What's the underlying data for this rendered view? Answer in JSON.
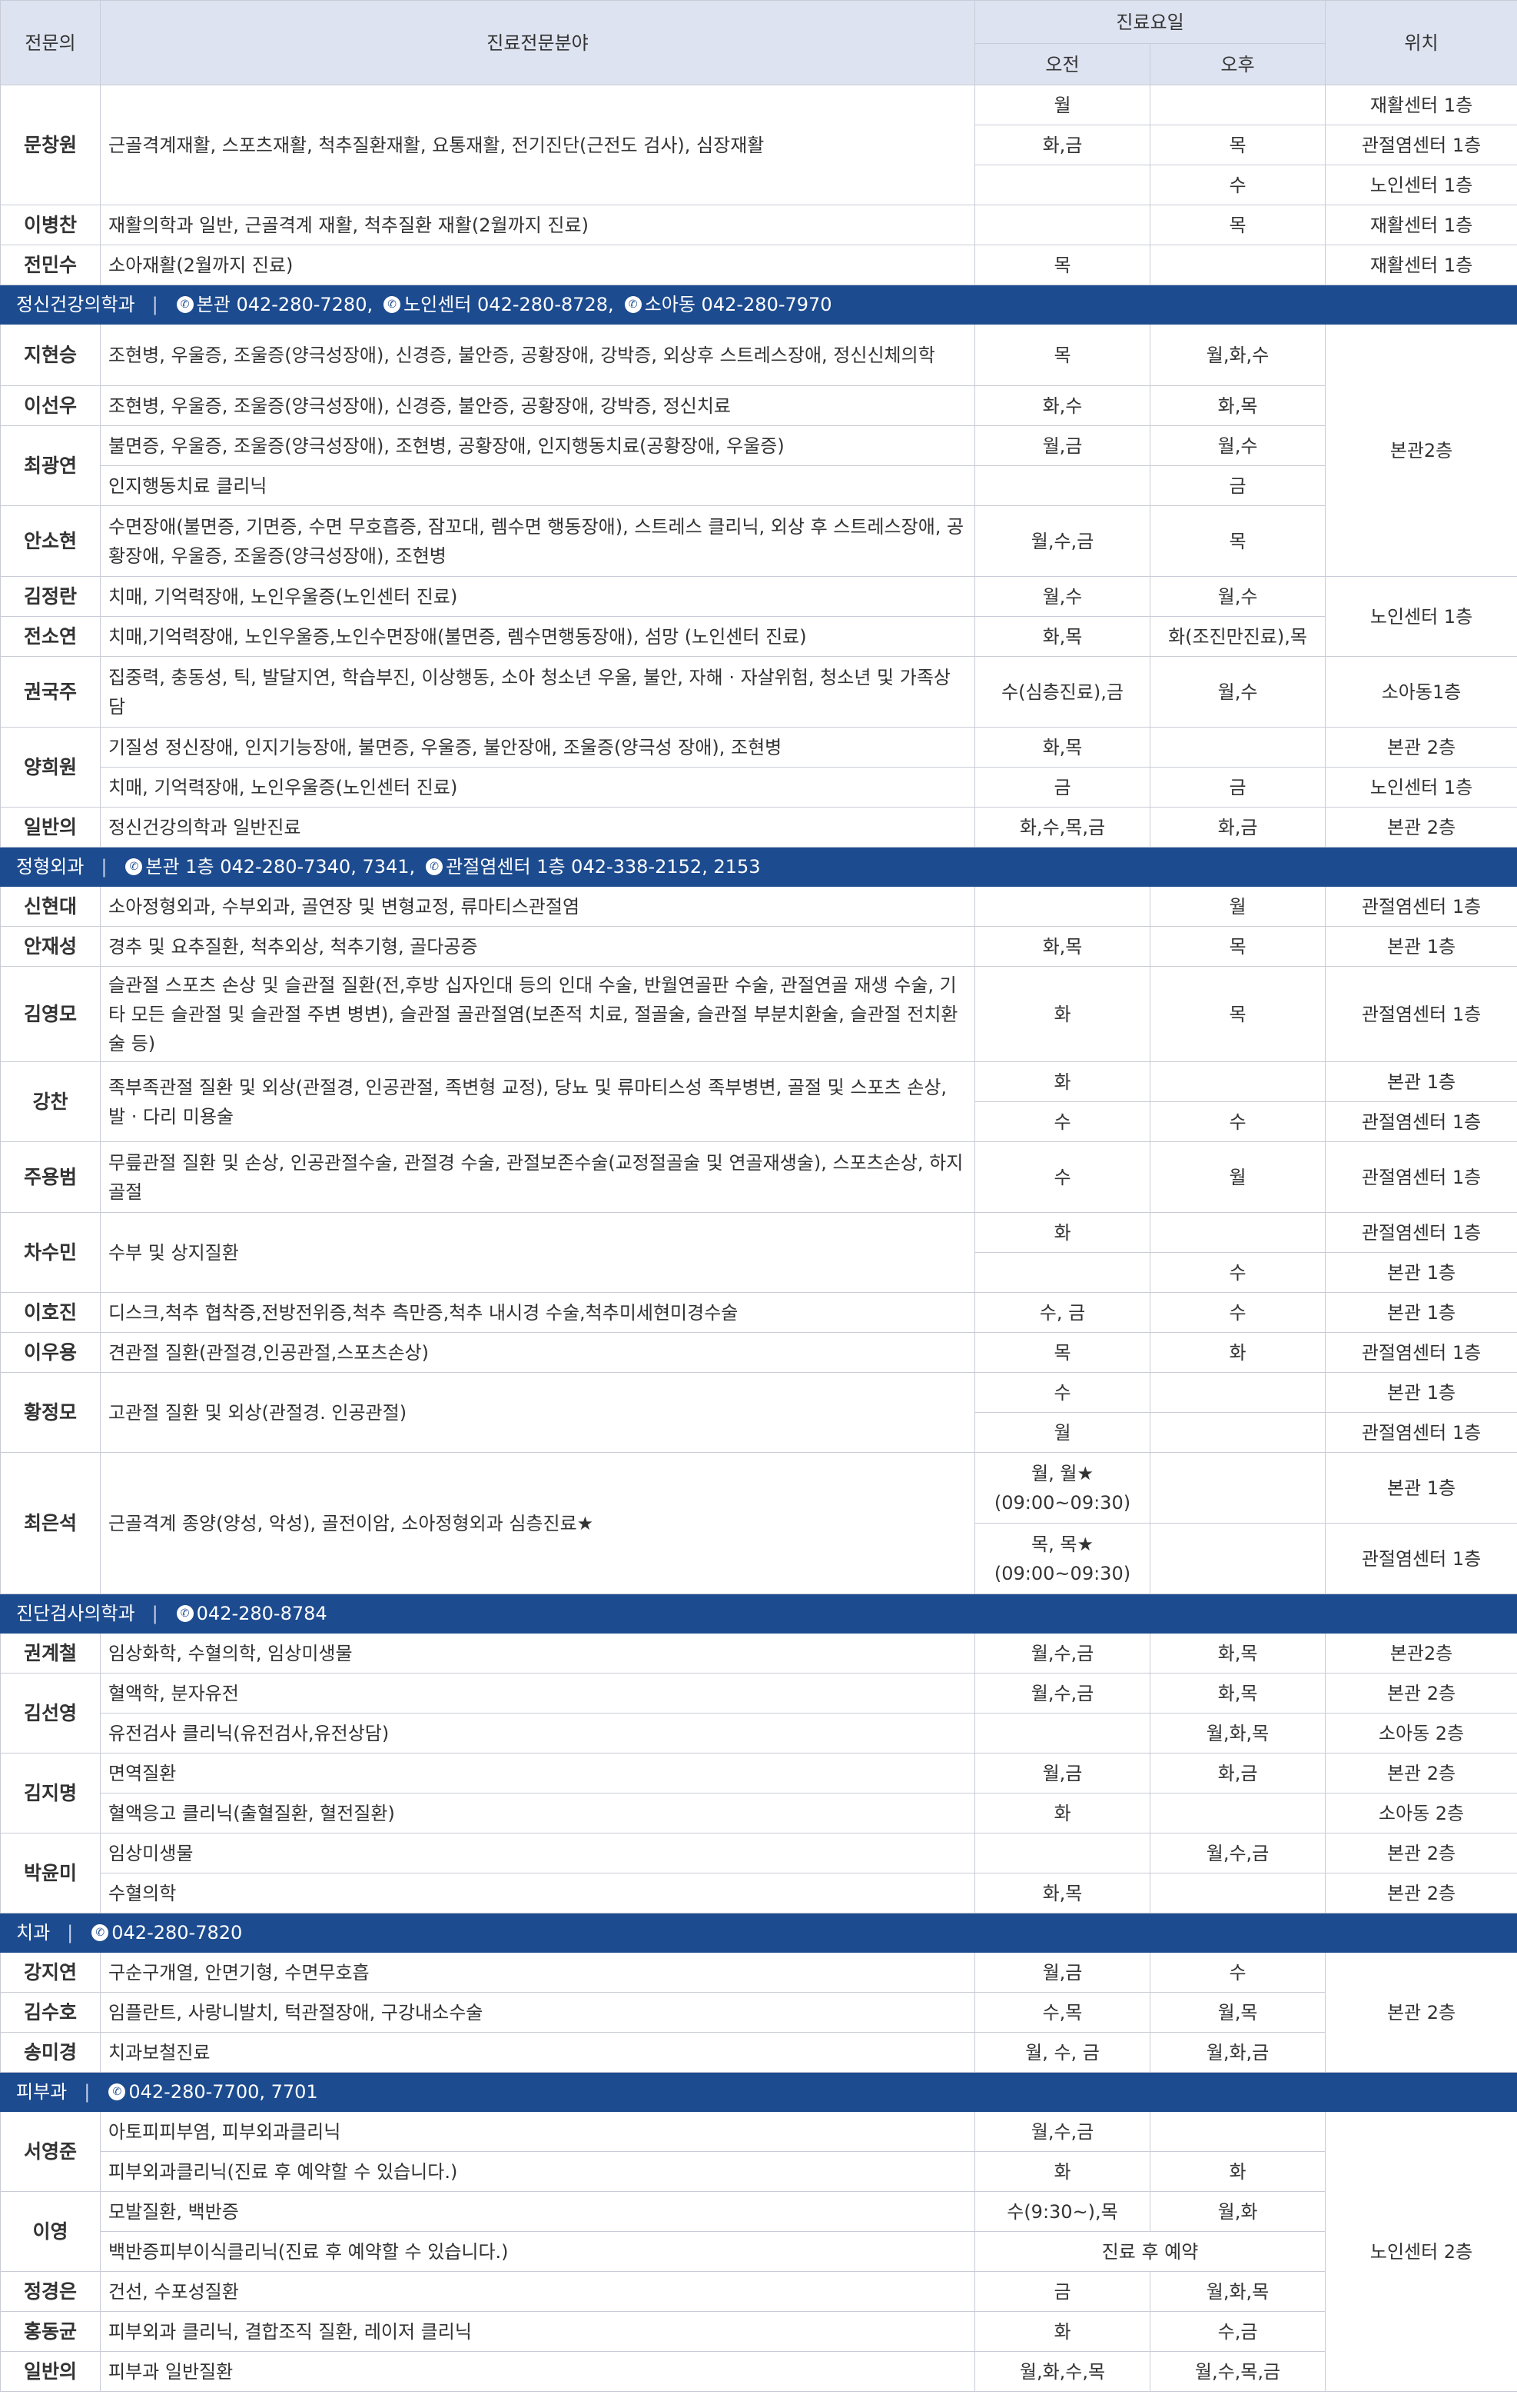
{
  "headers": {
    "doctor": "전문의",
    "field": "진료전문분야",
    "days": "진료요일",
    "am": "오전",
    "pm": "오후",
    "location": "위치"
  },
  "rows": [
    {
      "type": "row",
      "doc": "문창원",
      "docSpan": 3,
      "field": "근골격계재활, 스포츠재활, 척추질환재활, 요통재활, 전기진단(근전도 검사), 심장재활",
      "fieldSpan": 3,
      "am": "월",
      "pm": "",
      "loc": "재활센터 1층",
      "h": 52
    },
    {
      "type": "row",
      "am": "화,금",
      "pm": "목",
      "loc": "관절염센터 1층",
      "h": 52
    },
    {
      "type": "row",
      "am": "",
      "pm": "수",
      "loc": "노인센터 1층",
      "h": 52
    },
    {
      "type": "row",
      "doc": "이병찬",
      "field": "재활의학과 일반, 근골격계 재활, 척추질환 재활(2월까지 진료)",
      "am": "",
      "pm": "목",
      "loc": "재활센터 1층",
      "h": 52
    },
    {
      "type": "row",
      "doc": "전민수",
      "field": "소아재활(2월까지 진료)",
      "am": "목",
      "pm": "",
      "loc": "재활센터 1층",
      "h": 52
    },
    {
      "type": "sec",
      "title": "정신건강의학과",
      "phones": [
        "본관 042-280-7280,",
        "노인센터 042-280-8728,",
        "소아동 042-280-7970"
      ],
      "h": 50
    },
    {
      "type": "row",
      "doc": "지현승",
      "field": "조현병, 우울증, 조울증(양극성장애), 신경증, 불안증, 공황장애, 강박증, 외상후 스트레스장애, 정신신체의학",
      "am": "목",
      "pm": "월,화,수",
      "loc": "본관2층",
      "locSpan": 5,
      "h": 80
    },
    {
      "type": "row",
      "doc": "이선우",
      "field": "조현병, 우울증, 조울증(양극성장애), 신경증, 불안증, 공황장애, 강박증, 정신치료",
      "am": "화,수",
      "pm": "화,목",
      "h": 52
    },
    {
      "type": "row",
      "doc": "최광연",
      "docSpan": 2,
      "field": "불면증, 우울증, 조울증(양극성장애), 조현병, 공황장애, 인지행동치료(공황장애, 우울증)",
      "am": "월,금",
      "pm": "월,수",
      "h": 52
    },
    {
      "type": "row",
      "field": "인지행동치료 클리닉",
      "am": "",
      "pm": "금",
      "h": 52
    },
    {
      "type": "row",
      "doc": "안소현",
      "field": "수면장애(불면증, 기면증, 수면 무호흡증, 잠꼬대, 렘수면 행동장애), 스트레스 클리닉, 외상 후 스트레스장애, 공황장애, 우울증, 조울증(양극성장애), 조현병",
      "am": "월,수,금",
      "pm": "목",
      "h": 92
    },
    {
      "type": "row",
      "doc": "김정란",
      "field": "치매, 기억력장애, 노인우울증(노인센터 진료)",
      "am": "월,수",
      "pm": "월,수",
      "loc": "노인센터 1층",
      "locSpan": 2,
      "h": 52
    },
    {
      "type": "row",
      "doc": "전소연",
      "field": "치매,기억력장애, 노인우울증,노인수면장애(불면증, 렘수면행동장애), 섬망 (노인센터 진료)",
      "am": "화,목",
      "pm": "화(조진만진료),목",
      "h": 52
    },
    {
      "type": "row",
      "doc": "권국주",
      "field": "집중력, 충동성, 틱, 발달지연, 학습부진, 이상행동, 소아 청소년 우울, 불안, 자해 · 자살위험, 청소년 및 가족상담",
      "am": "수(심층진료),금",
      "pm": "월,수",
      "loc": "소아동1층",
      "h": 92
    },
    {
      "type": "row",
      "doc": "양희원",
      "docSpan": 2,
      "field": "기질성 정신장애, 인지기능장애, 불면증, 우울증, 불안장애, 조울증(양극성 장애), 조현병",
      "am": "화,목",
      "pm": "",
      "loc": "본관 2층",
      "h": 52
    },
    {
      "type": "row",
      "field": "치매, 기억력장애, 노인우울증(노인센터 진료)",
      "am": "금",
      "pm": "금",
      "loc": "노인센터 1층",
      "h": 52
    },
    {
      "type": "row",
      "doc": "일반의",
      "field": "정신건강의학과 일반진료",
      "am": "화,수,목,금",
      "pm": "화,금",
      "loc": "본관 2층",
      "h": 52
    },
    {
      "type": "sec",
      "title": "정형외과",
      "phones": [
        "본관 1층 042-280-7340, 7341,",
        "관절염센터 1층 042-338-2152, 2153"
      ],
      "h": 50
    },
    {
      "type": "row",
      "doc": "신현대",
      "field": "소아정형외과, 수부외과, 골연장 및 변형교정, 류마티스관절염",
      "am": "",
      "pm": "월",
      "loc": "관절염센터 1층",
      "h": 52
    },
    {
      "type": "row",
      "doc": "안재성",
      "field": "경추 및 요추질환, 척추외상, 척추기형, 골다공증",
      "am": "화,목",
      "pm": "목",
      "loc": "본관 1층",
      "h": 52
    },
    {
      "type": "row",
      "doc": "김영모",
      "field": "슬관절 스포츠 손상 및 슬관절 질환(전,후방 십자인대 등의 인대 수술, 반월연골판 수술, 관절연골 재생 수술, 기타 모든 슬관절 및 슬관절 주변 병변), 슬관절 골관절염(보존적 치료, 절골술, 슬관절 부분치환술, 슬관절 전치환술 등)",
      "am": "화",
      "pm": "목",
      "loc": "관절염센터 1층",
      "h": 124
    },
    {
      "type": "row",
      "doc": "강찬",
      "docSpan": 2,
      "field": "족부족관절 질환 및 외상(관절경, 인공관절, 족변형 교정), 당뇨 및 류마티스성 족부병변, 골절 및 스포츠 손상, 발 · 다리 미용술",
      "fieldSpan": 2,
      "am": "화",
      "pm": "",
      "loc": "본관 1층",
      "h": 52
    },
    {
      "type": "row",
      "am": "수",
      "pm": "수",
      "loc": "관절염센터 1층",
      "h": 52
    },
    {
      "type": "row",
      "doc": "주용범",
      "field": "무릎관절 질환 및 손상, 인공관절수술, 관절경 수술, 관절보존수술(교정절골술 및 연골재생술), 스포츠손상, 하지골절",
      "am": "수",
      "pm": "월",
      "loc": "관절염센터 1층",
      "h": 92
    },
    {
      "type": "row",
      "doc": "차수민",
      "docSpan": 2,
      "field": "수부 및 상지질환",
      "fieldSpan": 2,
      "am": "화",
      "pm": "",
      "loc": "관절염센터 1층",
      "h": 52
    },
    {
      "type": "row",
      "am": "",
      "pm": "수",
      "loc": "본관 1층",
      "h": 52
    },
    {
      "type": "row",
      "doc": "이호진",
      "field": "디스크,척추 협착증,전방전위증,척추 측만증,척추 내시경 수술,척추미세현미경수술",
      "am": "수, 금",
      "pm": "수",
      "loc": "본관 1층",
      "h": 52
    },
    {
      "type": "row",
      "doc": "이우용",
      "field": "견관절 질환(관절경,인공관절,스포츠손상)",
      "am": "목",
      "pm": "화",
      "loc": "관절염센터 1층",
      "h": 52
    },
    {
      "type": "row",
      "doc": "황정모",
      "docSpan": 2,
      "field": "고관절 질환 및 외상(관절경. 인공관절)",
      "fieldSpan": 2,
      "am": "수",
      "pm": "",
      "loc": "본관 1층",
      "h": 52
    },
    {
      "type": "row",
      "am": "월",
      "pm": "",
      "loc": "관절염센터 1층",
      "h": 52
    },
    {
      "type": "row",
      "doc": "최은석",
      "docSpan": 2,
      "field": "근골격계 종양(양성, 악성), 골전이암, 소아정형외과 심층진료★",
      "fieldSpan": 2,
      "am": "월, 월★",
      "am2": "(09:00~09:30)",
      "pm": "",
      "loc": "본관 1층",
      "h": 92
    },
    {
      "type": "row",
      "am": "목, 목★",
      "am2": "(09:00~09:30)",
      "pm": "",
      "loc": "관절염센터 1층",
      "h": 92
    },
    {
      "type": "sec",
      "title": "진단검사의학과",
      "phones": [
        "042-280-8784"
      ],
      "h": 50
    },
    {
      "type": "row",
      "doc": "권계철",
      "field": "임상화학, 수혈의학, 임상미생물",
      "am": "월,수,금",
      "pm": "화,목",
      "loc": "본관2층",
      "h": 52
    },
    {
      "type": "row",
      "doc": "김선영",
      "docSpan": 2,
      "field": "혈액학, 분자유전",
      "am": "월,수,금",
      "pm": "화,목",
      "loc": "본관 2층",
      "h": 52
    },
    {
      "type": "row",
      "field": "유전검사 클리닉(유전검사,유전상담)",
      "am": "",
      "pm": "월,화,목",
      "loc": "소아동 2층",
      "h": 52
    },
    {
      "type": "row",
      "doc": "김지명",
      "docSpan": 2,
      "field": "면역질환",
      "am": "월,금",
      "pm": "화,금",
      "loc": "본관 2층",
      "h": 52
    },
    {
      "type": "row",
      "field": "혈액응고 클리닉(출혈질환, 혈전질환)",
      "am": "화",
      "pm": "",
      "loc": "소아동 2층",
      "h": 52
    },
    {
      "type": "row",
      "doc": "박윤미",
      "docSpan": 2,
      "field": "임상미생물",
      "am": "",
      "pm": "월,수,금",
      "loc": "본관 2층",
      "h": 52
    },
    {
      "type": "row",
      "field": "수혈의학",
      "am": "화,목",
      "pm": "",
      "loc": "본관 2층",
      "h": 52
    },
    {
      "type": "sec",
      "title": "치과",
      "phones": [
        "042-280-7820"
      ],
      "h": 50
    },
    {
      "type": "row",
      "doc": "강지연",
      "field": "구순구개열, 안면기형, 수면무호흡",
      "am": "월,금",
      "pm": "수",
      "loc": "본관 2층",
      "locSpan": 3,
      "h": 52
    },
    {
      "type": "row",
      "doc": "김수호",
      "field": "임플란트, 사랑니발치, 턱관절장애, 구강내소수술",
      "am": "수,목",
      "pm": "월,목",
      "h": 52
    },
    {
      "type": "row",
      "doc": "송미경",
      "field": "치과보철진료",
      "am": "월, 수, 금",
      "pm": "월,화,금",
      "h": 52
    },
    {
      "type": "sec",
      "title": "피부과",
      "phones": [
        "042-280-7700, 7701"
      ],
      "h": 50
    },
    {
      "type": "row",
      "doc": "서영준",
      "docSpan": 2,
      "field": "아토피피부염, 피부외과클리닉",
      "am": "월,수,금",
      "pm": "",
      "loc": "노인센터 2층",
      "locSpan": 7,
      "h": 52
    },
    {
      "type": "row",
      "field": "피부외과클리닉(진료 후 예약할 수 있습니다.)",
      "am": "화",
      "pm": "화",
      "h": 52
    },
    {
      "type": "row",
      "doc": "이영",
      "docSpan": 2,
      "field": "모발질환, 백반증",
      "am": "수(9:30~),목",
      "pm": "월,화",
      "h": 52
    },
    {
      "type": "row",
      "field": "백반증피부이식클리닉(진료 후 예약할 수 있습니다.)",
      "both": "진료 후 예약",
      "h": 52
    },
    {
      "type": "row",
      "doc": "정경은",
      "field": "건선, 수포성질환",
      "am": "금",
      "pm": "월,화,목",
      "h": 52
    },
    {
      "type": "row",
      "doc": "홍동균",
      "field": "피부외과 클리닉, 결합조직 질환, 레이저 클리닉",
      "am": "화",
      "pm": "수,금",
      "h": 52
    },
    {
      "type": "row",
      "doc": "일반의",
      "field": "피부과 일반질환",
      "am": "월,화,수,목",
      "pm": "월,수,목,금",
      "h": 52
    }
  ],
  "icons": {
    "phone": "phone-icon"
  },
  "colors": {
    "section_bg": "#1d4b8f",
    "header_bg": "#dde3f0",
    "border": "#c9ccd6"
  }
}
